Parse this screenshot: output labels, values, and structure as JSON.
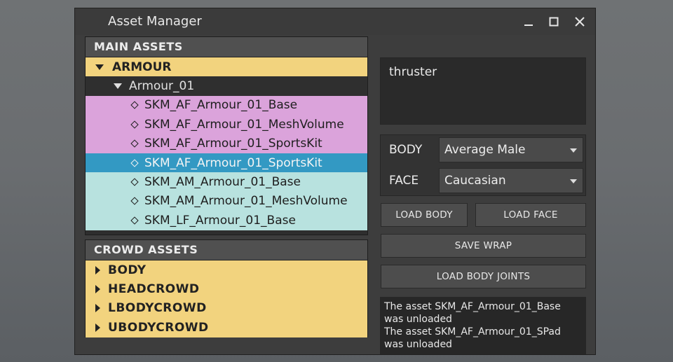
{
  "window": {
    "title": "Asset Manager"
  },
  "main_assets": {
    "header": "MAIN ASSETS",
    "category": "ARMOUR",
    "group": "Armour_01",
    "items": [
      {
        "label": "SKM_AF_Armour_01_Base",
        "color": "pink"
      },
      {
        "label": "SKM_AF_Armour_01_MeshVolume",
        "color": "pink"
      },
      {
        "label": "SKM_AF_Armour_01_SportsKit",
        "color": "pink"
      },
      {
        "label": "SKM_AF_Armour_01_SportsKit",
        "color": "blue",
        "selected": true
      },
      {
        "label": "SKM_AM_Armour_01_Base",
        "color": "cyan"
      },
      {
        "label": "SKM_AM_Armour_01_MeshVolume",
        "color": "cyan"
      },
      {
        "label": "SKM_LF_Armour_01_Base",
        "color": "cyan"
      }
    ]
  },
  "crowd_assets": {
    "header": "CROWD ASSETS",
    "items": [
      "BODY",
      "HEADCROWD",
      "LBODYCROWD",
      "UBODYCROWD"
    ]
  },
  "search_text": "thruster",
  "body_select": {
    "label": "BODY",
    "value": "Average Male"
  },
  "face_select": {
    "label": "FACE",
    "value": "Caucasian"
  },
  "buttons": {
    "load_body": "LOAD BODY",
    "load_face": "LOAD FACE",
    "save_wrap": "SAVE WRAP",
    "load_body_joints": "LOAD BODY JOINTS"
  },
  "log": [
    "The asset SKM_AF_Armour_01_Base was unloaded",
    "The asset SKM_AF_Armour_01_SPad was unloaded"
  ],
  "colors": {
    "yellow": "#f2d37e",
    "pink": "#dba3db",
    "blue": "#3399c3",
    "cyan": "#b8e2df"
  },
  "icons": {
    "minimize": "minimize-icon",
    "maximize": "maximize-icon",
    "close": "close-icon"
  }
}
